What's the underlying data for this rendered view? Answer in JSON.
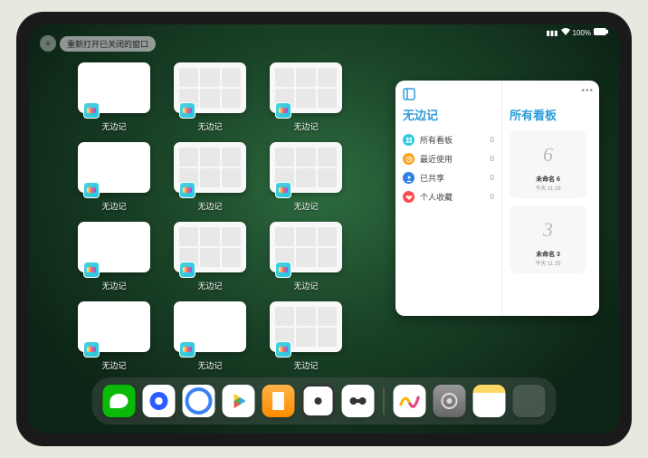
{
  "status": {
    "battery": "100%",
    "wifi": "wifi-icon",
    "signal": "signal-icon"
  },
  "topbar": {
    "reopen_label": "重新打开已关闭的窗口"
  },
  "windows": {
    "label": "无边记",
    "tiles": [
      {
        "type": "blank"
      },
      {
        "type": "grid"
      },
      {
        "type": "grid"
      },
      {
        "type": "blank"
      },
      {
        "type": "grid"
      },
      {
        "type": "grid"
      },
      {
        "type": "blank"
      },
      {
        "type": "grid"
      },
      {
        "type": "grid"
      },
      {
        "type": "blank"
      },
      {
        "type": "blank"
      },
      {
        "type": "grid"
      }
    ]
  },
  "sidepanel": {
    "left_title": "无边记",
    "right_title": "所有看板",
    "rows": [
      {
        "icon": "grid",
        "color": "#2ecae5",
        "label": "所有看板",
        "count": "0"
      },
      {
        "icon": "clock",
        "color": "#ff9f1a",
        "label": "最近使用",
        "count": "0"
      },
      {
        "icon": "person",
        "color": "#2e7fe5",
        "label": "已共享",
        "count": "0"
      },
      {
        "icon": "heart",
        "color": "#ff4d4d",
        "label": "个人收藏",
        "count": "0"
      }
    ],
    "boards": [
      {
        "sketch": "6",
        "title": "未命名 6",
        "sub": "今天 11:28"
      },
      {
        "sketch": "3",
        "title": "未命名 3",
        "sub": "今天 11:25"
      }
    ]
  },
  "dock": {
    "apps": [
      {
        "name": "wechat",
        "class": "i-wechat"
      },
      {
        "name": "qq",
        "class": "i-qq"
      },
      {
        "name": "quark",
        "class": "i-quark"
      },
      {
        "name": "play",
        "class": "i-play"
      },
      {
        "name": "books",
        "class": "i-tv"
      },
      {
        "name": "dice",
        "class": "i-dice"
      },
      {
        "name": "cards",
        "class": "i-cards"
      }
    ],
    "recent": [
      {
        "name": "freeform",
        "class": "i-freeform"
      },
      {
        "name": "settings",
        "class": "i-settings"
      },
      {
        "name": "notes",
        "class": "i-notes"
      },
      {
        "name": "app-library",
        "class": "i-apps"
      }
    ]
  }
}
